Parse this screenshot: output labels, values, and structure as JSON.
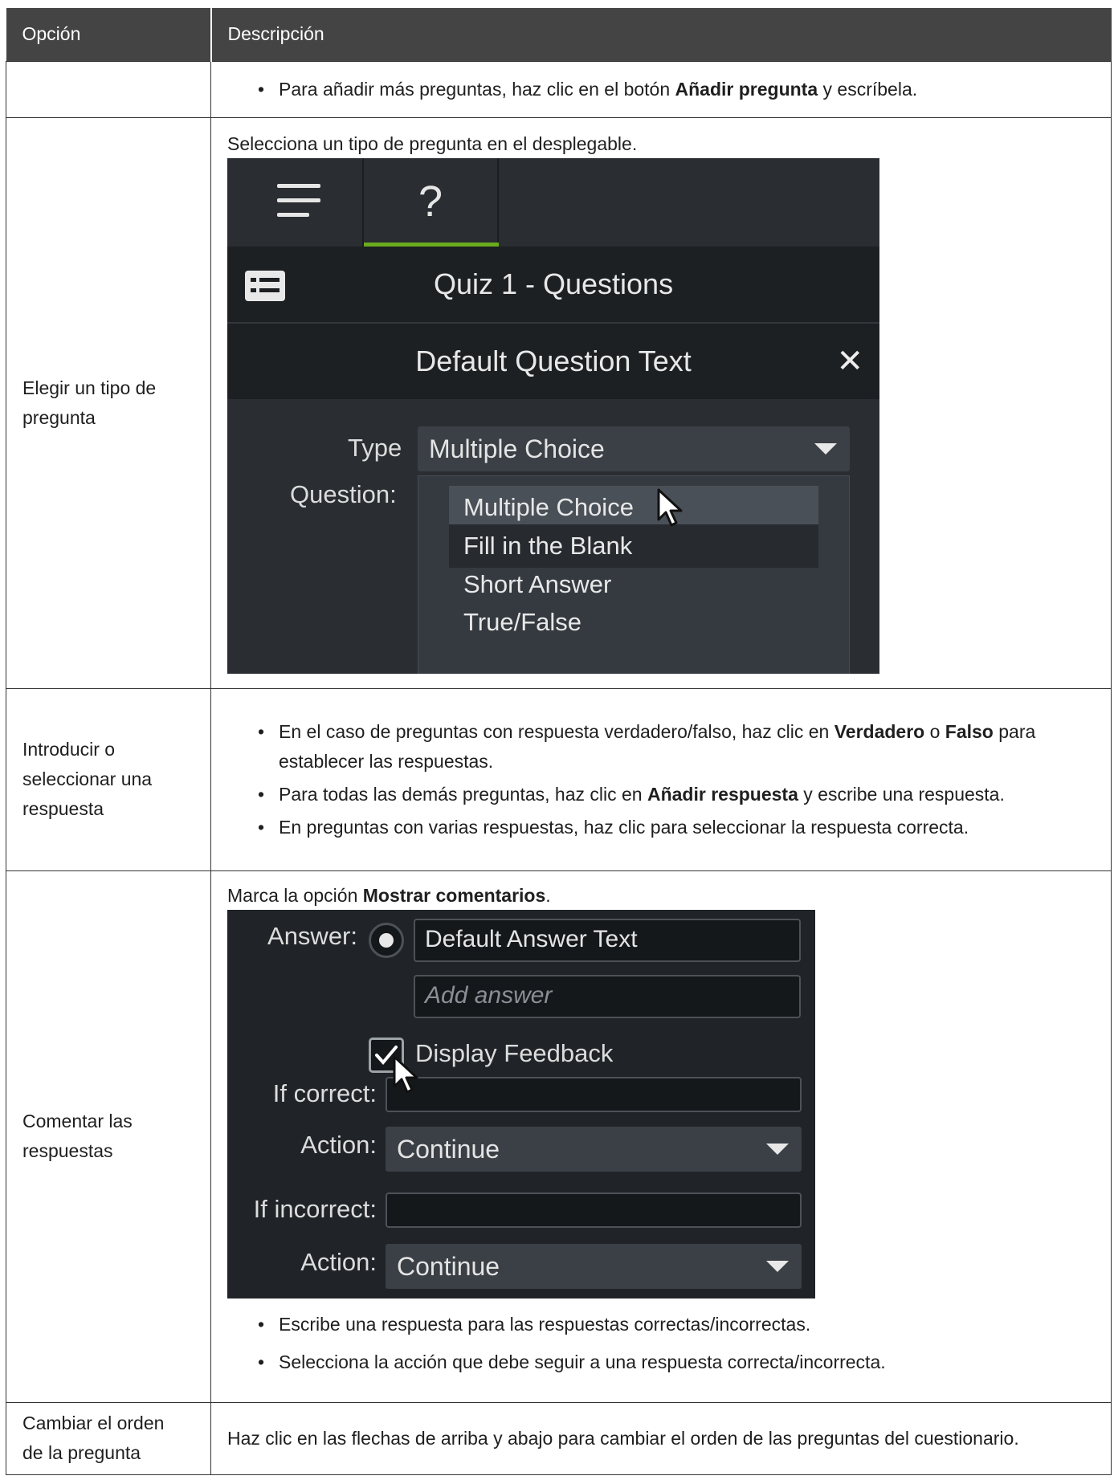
{
  "table": {
    "header": {
      "col1": "Opción",
      "col2": "Descripción"
    },
    "row0": {
      "bullet1_pre": "Para añadir más preguntas, haz clic en el botón ",
      "bullet1_bold": "Añadir pregunta",
      "bullet1_post": " y escríbela."
    },
    "row1": {
      "option_line1": "Elegir un tipo de",
      "option_line2": "pregunta",
      "intro": "Selecciona un tipo de pregunta en el desplegable."
    },
    "row2": {
      "option_line1": "Introducir o",
      "option_line2": "seleccionar una",
      "option_line3": "respuesta",
      "b1_pre": "En el caso de preguntas con respuesta verdadero/falso, haz clic en ",
      "b1_bold1": "Verdadero",
      "b1_mid": " o ",
      "b1_bold2": "Falso",
      "b1_post1": " para",
      "b1_line2": "establecer las respuestas.",
      "b2_pre": "Para todas las demás preguntas, haz clic en ",
      "b2_bold": "Añadir respuesta",
      "b2_post": " y escribe una respuesta.",
      "b3": "En preguntas con varias respuestas, haz clic para seleccionar la respuesta correcta."
    },
    "row3": {
      "option_line1": "Comentar las",
      "option_line2": "respuestas",
      "intro_pre": "Marca la opción ",
      "intro_bold": "Mostrar comentarios",
      "intro_post": ".",
      "b1": "Escribe una respuesta para las respuestas correctas/incorrectas.",
      "b2": "Selecciona la acción que debe seguir a una respuesta correcta/incorrecta."
    },
    "row4": {
      "option_line1": "Cambiar el orden",
      "option_line2": "de la pregunta",
      "desc": "Haz clic en las flechas de arriba y abajo para cambiar el orden de las preguntas del cuestionario."
    }
  },
  "screenshot1": {
    "icons": {
      "menu": "hamburger-icon",
      "help": "question-mark-icon",
      "quiz": "quiz-list-icon",
      "close": "close-icon",
      "dropdown": "triangle-down-icon",
      "pointer": "mouse-cursor-icon"
    },
    "tab_help_glyph": "?",
    "panel_title": "Quiz 1 - Questions",
    "question_title": "Default Question Text",
    "close_glyph": "✕",
    "type_label": "Type",
    "type_value": "Multiple Choice",
    "question_label": "Question:",
    "options": [
      "Multiple Choice",
      "Fill in the Blank",
      "Short Answer",
      "True/False"
    ],
    "accent_color": "#6bab1e"
  },
  "screenshot2": {
    "answer_label": "Answer:",
    "answer_value": "Default Answer Text",
    "add_answer_placeholder": "Add answer",
    "display_feedback_label": "Display Feedback",
    "display_feedback_checked": true,
    "if_correct_label": "If correct:",
    "action_label": "Action:",
    "action_correct_value": "Continue",
    "if_incorrect_label": "If incorrect:",
    "action_incorrect_value": "Continue"
  }
}
